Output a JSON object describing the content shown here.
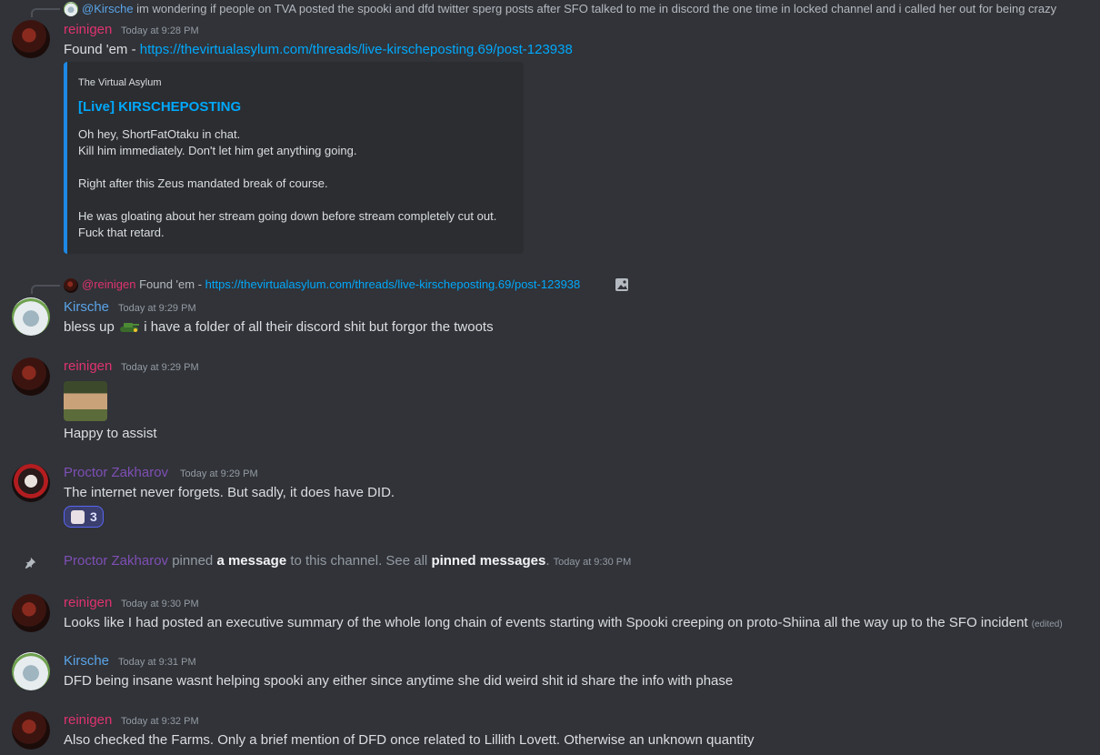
{
  "messages": {
    "reply1": {
      "mention": "@Kirsche",
      "text": "im wondering if people on TVA posted the spooki and dfd twitter sperg posts after SFO talked to me in discord the one time in locked channel and i called her out for being crazy"
    },
    "m1": {
      "author": "reinigen",
      "time": "Today at 9:28 PM",
      "prefix": "Found 'em - ",
      "link": "https://thevirtualasylum.com/threads/live-kirscheposting.69/post-123938"
    },
    "embed": {
      "provider": "The Virtual Asylum",
      "title": "[Live] KIRSCHEPOSTING",
      "description": "Oh hey, ShortFatOtaku in chat.\nKill him immediately. Don't let him get anything going.\n\nRight after this Zeus mandated break of course.\n\nHe was gloating about her stream going down before stream completely cut out.\nFuck that retard."
    },
    "reply2": {
      "mention": "@reinigen",
      "prefix": "Found 'em - ",
      "link": "https://thevirtualasylum.com/threads/live-kirscheposting.69/post-123938"
    },
    "m2": {
      "author": "Kirsche",
      "time": "Today at 9:29 PM",
      "text_before": "bless up ",
      "text_after": " i have a folder of all their discord shit but forgor the twoots"
    },
    "m3": {
      "author": "reinigen",
      "time": "Today at 9:29 PM",
      "text": "Happy to assist"
    },
    "m4": {
      "author": "Proctor Zakharov",
      "time": "Today at 9:29 PM",
      "text": "The internet never forgets. But sadly, it does have DID.",
      "reaction_count": "3"
    },
    "system": {
      "author": "Proctor Zakharov",
      "t1": " pinned ",
      "b1": "a message",
      "t2": " to this channel. See all ",
      "b2": "pinned messages",
      "t3": ".",
      "time": "Today at 9:30 PM"
    },
    "m5": {
      "author": "reinigen",
      "time": "Today at 9:30 PM",
      "text": "Looks like I had posted an executive summary of the whole long chain of events starting with Spooki creeping on proto-Shiina all the way up to the SFO incident",
      "edited": "(edited)"
    },
    "m6": {
      "author": "Kirsche",
      "time": "Today at 9:31 PM",
      "text": "DFD being insane wasnt helping spooki any either since anytime she did weird shit id share the info with phase"
    },
    "m7": {
      "author": "reinigen",
      "time": "Today at 9:32 PM",
      "text": "Also checked the Farms. Only a brief mention of DFD once related to Lillith Lovett. Otherwise an unknown quantity"
    }
  },
  "icons": {
    "pin": "pin-icon",
    "image": "image-icon",
    "emoji": "tank-emoji"
  }
}
